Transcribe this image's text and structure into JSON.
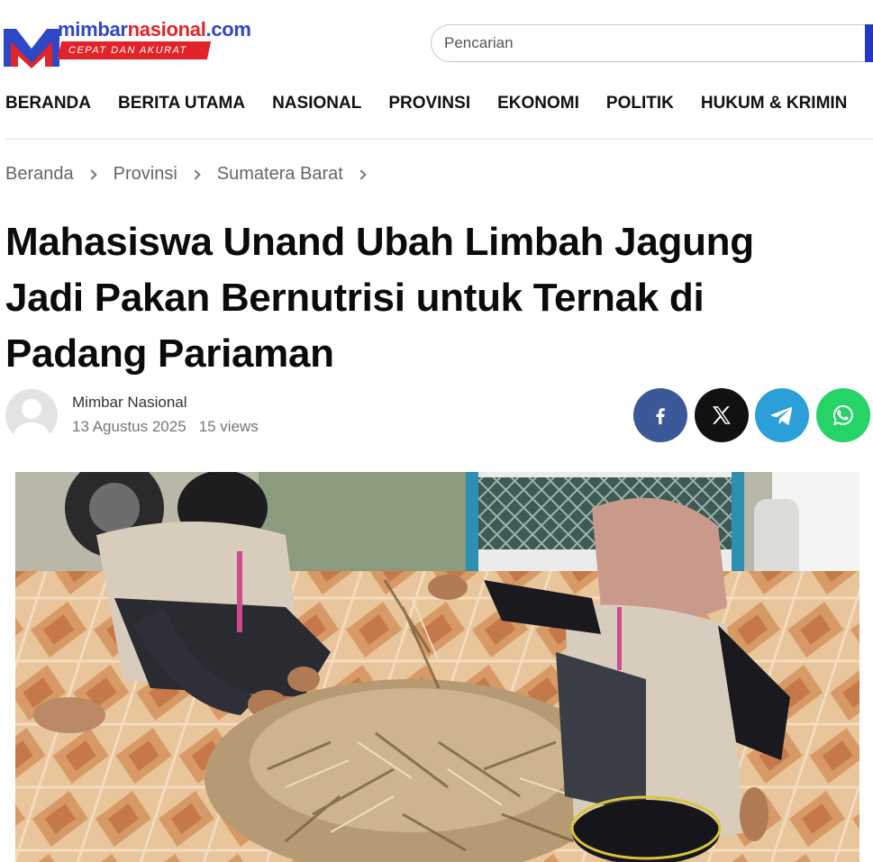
{
  "site": {
    "logo_part1": "mimbar",
    "logo_part2": "nasional",
    "logo_part3": ".com",
    "tagline": "CEPAT DAN AKURAT",
    "colors": {
      "brand_blue": "#2d47c6",
      "brand_red": "#e2232a"
    }
  },
  "search": {
    "placeholder": "Pencarian"
  },
  "nav": {
    "items": [
      "BERANDA",
      "BERITA UTAMA",
      "NASIONAL",
      "PROVINSI",
      "EKONOMI",
      "POLITIK",
      "HUKUM & KRIMIN"
    ]
  },
  "breadcrumb": [
    "Beranda",
    "Provinsi",
    "Sumatera Barat"
  ],
  "article": {
    "title": "Mahasiswa Unand Ubah Limbah Jagung Jadi Pakan Bernutrisi untuk Ternak di Padang Pariaman",
    "author": "Mimbar Nasional",
    "date": "13 Agustus 2025",
    "views": "15 views"
  },
  "share": {
    "icons": [
      "facebook-icon",
      "x-icon",
      "telegram-icon",
      "whatsapp-icon"
    ],
    "colors": {
      "facebook": "#3b5998",
      "x": "#111111",
      "telegram": "#2a9fd8",
      "whatsapp": "#25d366"
    }
  }
}
